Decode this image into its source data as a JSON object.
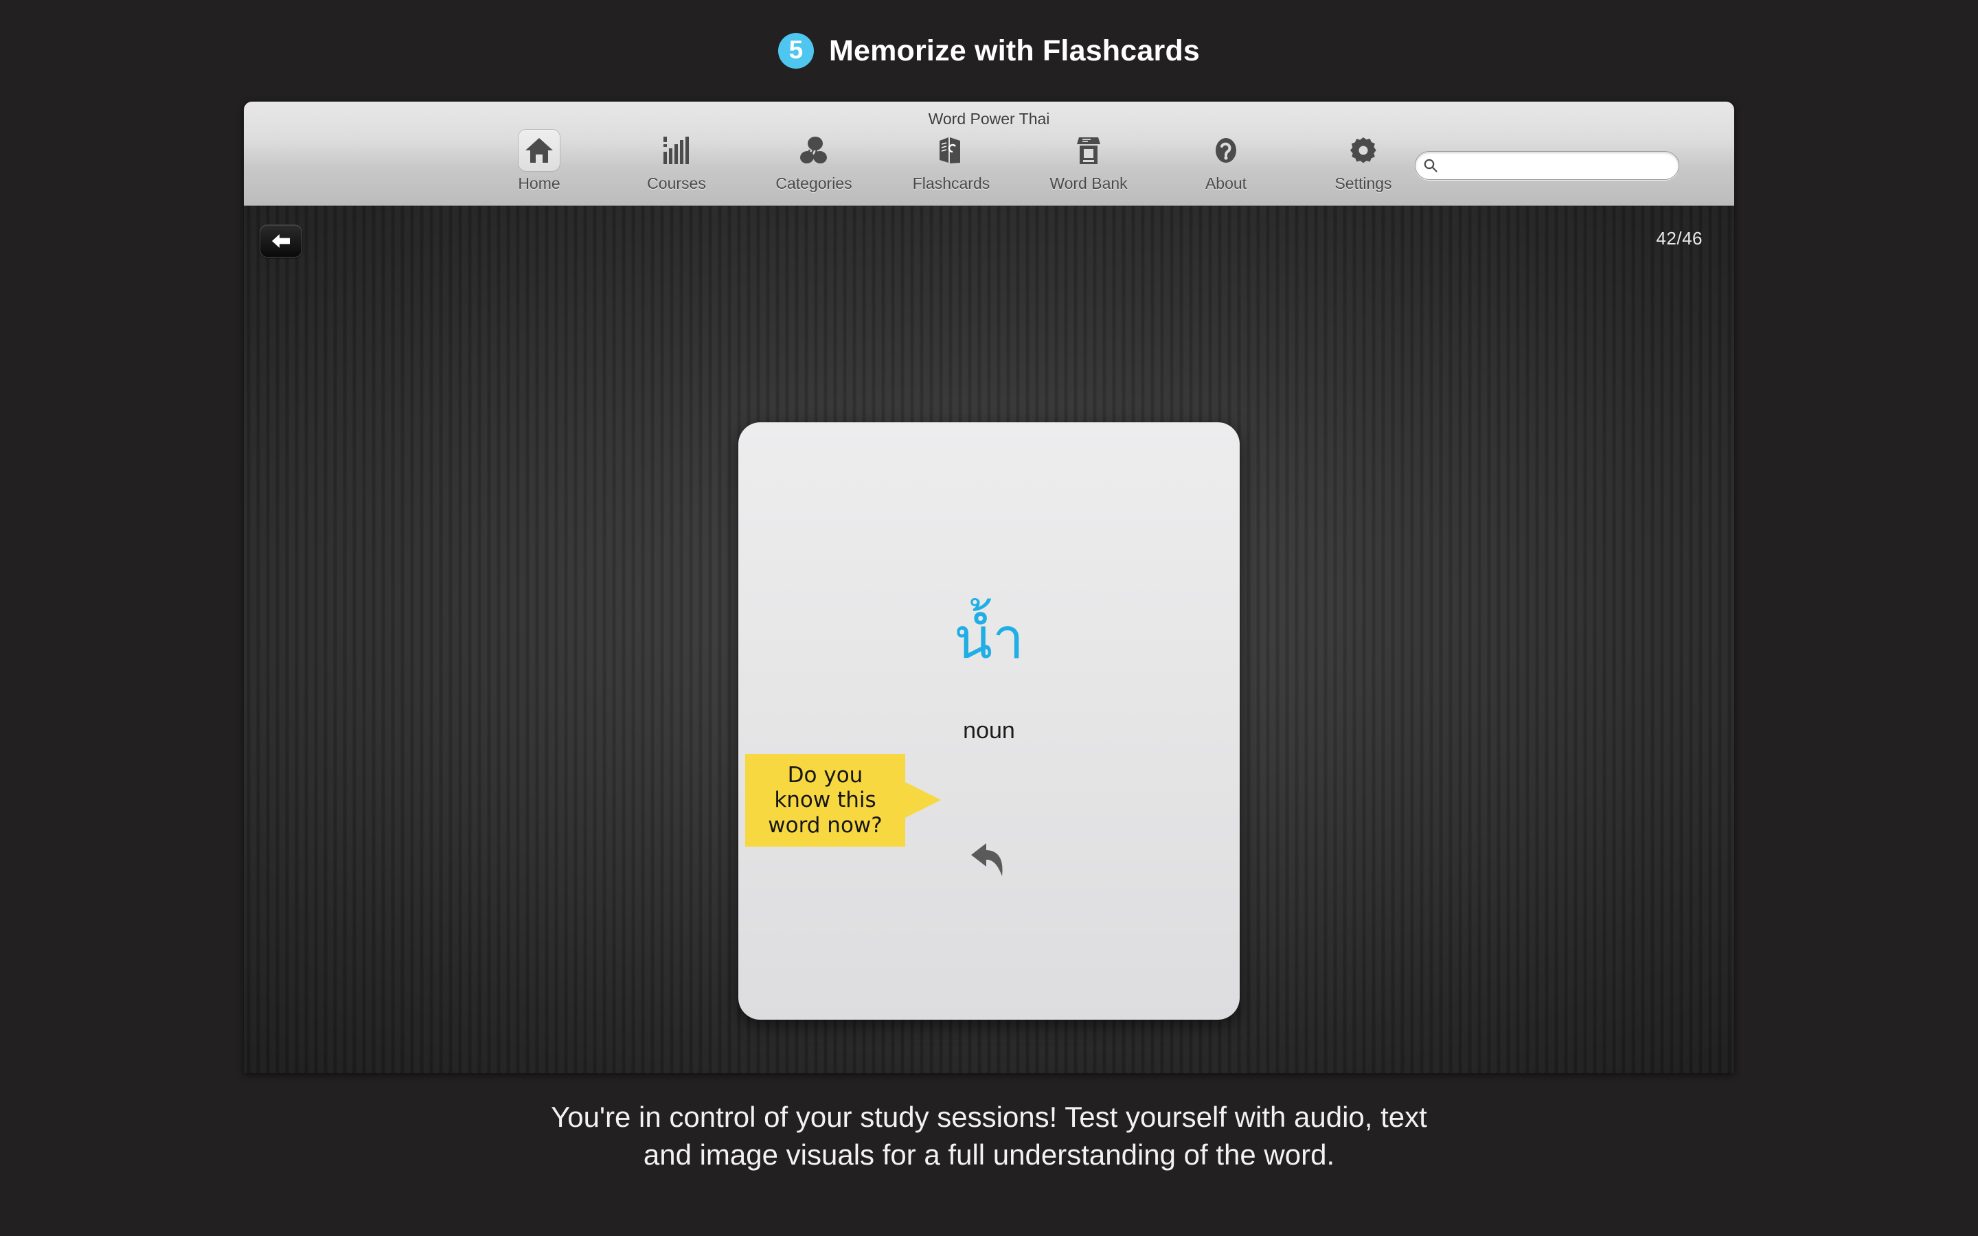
{
  "header": {
    "step_number": "5",
    "title": "Memorize with Flashcards",
    "accent_color": "#4ec6ef"
  },
  "app_window": {
    "window_title": "Word Power Thai",
    "toolbar": {
      "items": [
        {
          "label": "Home",
          "icon": "home-icon",
          "selected": true
        },
        {
          "label": "Courses",
          "icon": "bar-chart-icon",
          "selected": false
        },
        {
          "label": "Categories",
          "icon": "categories-icon",
          "selected": false
        },
        {
          "label": "Flashcards",
          "icon": "flashcards-icon",
          "selected": false
        },
        {
          "label": "Word Bank",
          "icon": "word-bank-icon",
          "selected": false
        },
        {
          "label": "About",
          "icon": "question-mark-icon",
          "selected": false
        },
        {
          "label": "Settings",
          "icon": "gear-icon",
          "selected": false
        }
      ],
      "search": {
        "value": "",
        "placeholder": "",
        "icon": "search-icon"
      }
    },
    "content": {
      "back_button_icon": "back-arrow-icon",
      "card_counter": "42/46",
      "flashcard": {
        "word": "น้ำ",
        "part_of_speech": "noun",
        "flip_icon": "flip-arrow-icon",
        "word_color": "#20aee5"
      },
      "speech_bubble": {
        "text": "Do you\nknow this\nword now?",
        "background_color": "#f7d841"
      }
    }
  },
  "caption": {
    "text": "You're in control of your study sessions! Test yourself with audio, text\nand image visuals for a full understanding of the word."
  }
}
